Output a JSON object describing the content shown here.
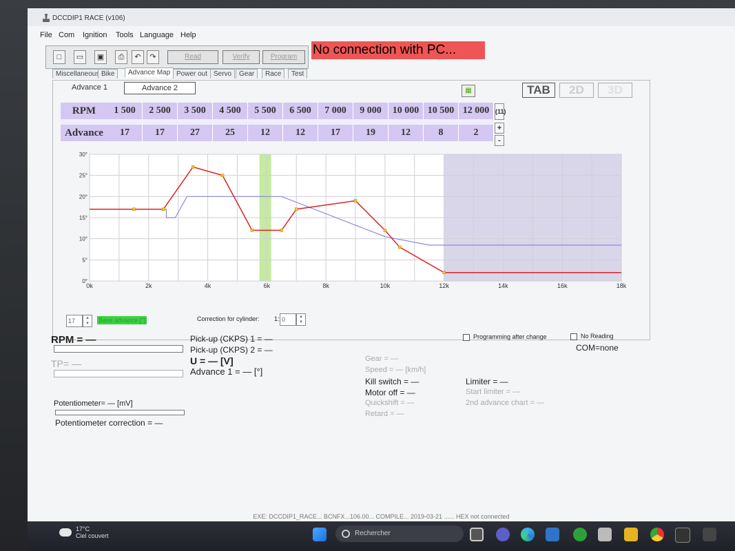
{
  "window": {
    "title": "DCCDIP1 RACE (v106)"
  },
  "menu": [
    "File",
    "Com",
    "Ignition",
    "Tools",
    "Language",
    "Help"
  ],
  "toolbar": {
    "read": "Read",
    "verify": "Verify",
    "program": "Program"
  },
  "status_banner": "No connection with PC...",
  "tabs": [
    "Miscellaneous",
    "Bike",
    "Advance Map",
    "Power out",
    "Servo",
    "Gear",
    "Race",
    "Test"
  ],
  "subtabs": [
    "Advance 1",
    "Advance 2"
  ],
  "view_buttons": [
    "TAB",
    "2D",
    "3D"
  ],
  "table": {
    "rpm_label": "RPM",
    "advance_label": "Advance",
    "count": "(11)",
    "plus": "+",
    "minus": "-",
    "rpm": [
      "1 500",
      "2 500",
      "3 500",
      "4 500",
      "5 500",
      "6 500",
      "7 000",
      "9 000",
      "10 000",
      "10 500",
      "12 000"
    ],
    "advance": [
      "17",
      "17",
      "27",
      "25",
      "12",
      "12",
      "17",
      "19",
      "12",
      "8",
      "2"
    ]
  },
  "chart_data": {
    "type": "line",
    "xlim": [
      0,
      18000
    ],
    "ylim": [
      0,
      30
    ],
    "x_ticks": [
      "0k",
      "2k",
      "4k",
      "6k",
      "8k",
      "10k",
      "12k",
      "14k",
      "16k",
      "18k"
    ],
    "y_ticks": [
      "0°",
      "5°",
      "10°",
      "15°",
      "20°",
      "25°",
      "30°"
    ],
    "grid": true,
    "series": [
      {
        "color": "#dd2222",
        "x": [
          0,
          1500,
          2500,
          3500,
          4500,
          5500,
          6500,
          7000,
          9000,
          10000,
          10500,
          12000,
          18000
        ],
        "y": [
          17,
          17,
          17,
          27,
          25,
          12,
          12,
          17,
          19,
          12,
          8,
          2,
          2
        ]
      },
      {
        "color": "#8a8ad8",
        "x": [
          0,
          2600,
          2600,
          2900,
          3300,
          6500,
          10000,
          11500,
          18000
        ],
        "y": [
          17,
          17,
          15,
          15,
          20,
          20,
          10.5,
          8.5,
          8.5
        ]
      }
    ],
    "highlight_band": [
      5750,
      6150
    ],
    "shaded_from": 12000
  },
  "controls": {
    "base_value": "17",
    "base_label": "Base advance [°]",
    "cyl_label": "Correction for cylinder:",
    "cyl_prefix": "1:",
    "cyl_value": "0"
  },
  "readings": {
    "rpm": "RPM = —",
    "tp": "TP= —",
    "pickup1": "Pick-up (CKPS) 1 = —",
    "pickup2": "Pick-up (CKPS) 2 = —",
    "u": "U = — [V]",
    "advance1": "Advance 1 = — [°]",
    "gear": "Gear = —",
    "speed": "Speed = — [km/h]",
    "kill": "Kill switch = —",
    "motoroff": "Motor off = —",
    "quickshift": "Quickshift = —",
    "retard": "Retard = —",
    "limiter": "Limiter = —",
    "start_limiter": "Start limiter = —",
    "second_chart": "2nd advance chart = —",
    "programming_after_change": "Programming after change",
    "no_reading": "No Reading",
    "com": "COM=none",
    "potentiometer": "Potentiometer= — [mV]",
    "pot_correction": "Potentiometer correction = —"
  },
  "statusbar": "EXE: DCCDIP1_RACE... BCNFX...106.00... COMPILE... 2019-03-21 ...... HEX not connected",
  "taskbar": {
    "temp": "17°C",
    "weather": "Ciel couvert",
    "search": "Rechercher"
  }
}
